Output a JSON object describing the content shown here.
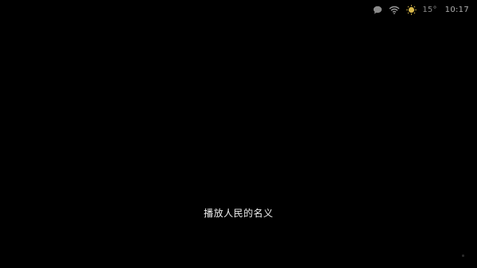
{
  "status_bar": {
    "icons": [
      "message-icon",
      "wifi-icon",
      "weather-sun-icon"
    ],
    "temperature": "15°",
    "time": "10:17"
  },
  "voice_prompt": {
    "text": "播放人民的名义"
  },
  "colors": {
    "background": "#000000",
    "status_text": "#9a9a9a",
    "prompt_text": "#f0f0f0",
    "weather_accent": "#d8b84a"
  }
}
